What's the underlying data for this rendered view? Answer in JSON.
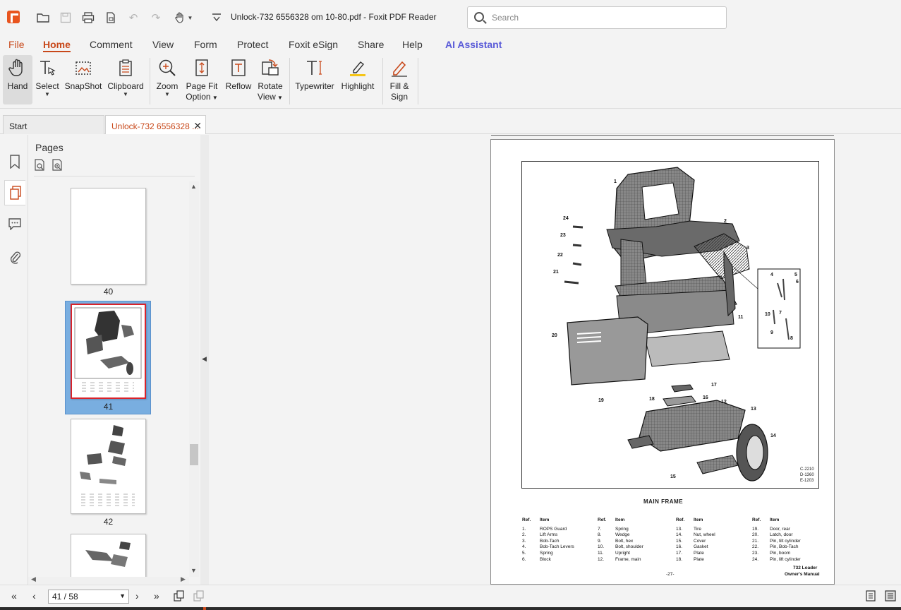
{
  "window": {
    "title": "Unlock-732 6556328 om 10-80.pdf - Foxit PDF Reader",
    "search_placeholder": "Search"
  },
  "quick_access": [
    {
      "name": "open-icon"
    },
    {
      "name": "save-icon"
    },
    {
      "name": "print-icon"
    },
    {
      "name": "new-page-icon"
    },
    {
      "name": "undo-icon"
    },
    {
      "name": "redo-icon"
    },
    {
      "name": "hand-tool-icon"
    },
    {
      "name": "customize-icon"
    }
  ],
  "menu_tabs": [
    "File",
    "Home",
    "Comment",
    "View",
    "Form",
    "Protect",
    "Foxit eSign",
    "Share",
    "Help",
    "AI Assistant"
  ],
  "active_menu_tab": "Home",
  "ribbon": {
    "hand": "Hand",
    "select": "Select",
    "snapshot": "SnapShot",
    "clipboard": "Clipboard",
    "zoom": "Zoom",
    "page_fit_1": "Page Fit",
    "page_fit_2": "Option",
    "reflow": "Reflow",
    "rotate_1": "Rotate",
    "rotate_2": "View",
    "typewriter": "Typewriter",
    "highlight": "Highlight",
    "fill_sign_1": "Fill &",
    "fill_sign_2": "Sign"
  },
  "doc_tabs": {
    "start": "Start",
    "active": "Unlock-732 6556328 ..."
  },
  "pages_panel": {
    "title": "Pages",
    "thumbnails": [
      "40",
      "41",
      "42"
    ],
    "selected": "41"
  },
  "document": {
    "figure_title": "MAIN FRAME",
    "figure_codes": [
      "C-2210",
      "D-1360",
      "E-1203"
    ],
    "callouts": [
      "1",
      "2",
      "3",
      "4",
      "5",
      "6",
      "7",
      "8",
      "9",
      "10",
      "11",
      "12",
      "13",
      "14",
      "15",
      "16",
      "17",
      "18",
      "19",
      "20",
      "21",
      "22",
      "23",
      "24"
    ],
    "ref_header": {
      "ref": "Ref.",
      "item": "Item"
    },
    "parts_columns": [
      [
        [
          "1.",
          "ROPS Guard"
        ],
        [
          "2.",
          "Lift Arms"
        ],
        [
          "3.",
          "Bob-Tach"
        ],
        [
          "4.",
          "Bob-Tach Levers"
        ],
        [
          "5.",
          "Spring"
        ],
        [
          "6.",
          "Block"
        ]
      ],
      [
        [
          "7.",
          "Spring"
        ],
        [
          "8.",
          "Wedge"
        ],
        [
          "9.",
          "Bolt, hex"
        ],
        [
          "10.",
          "Bolt, shoulder"
        ],
        [
          "11.",
          "Upright"
        ],
        [
          "12.",
          "Frame, main"
        ]
      ],
      [
        [
          "13.",
          "Tire"
        ],
        [
          "14.",
          "Nut, wheel"
        ],
        [
          "15.",
          "Cover"
        ],
        [
          "16.",
          "Gasket"
        ],
        [
          "17.",
          "Plate"
        ],
        [
          "18.",
          "Plate"
        ]
      ],
      [
        [
          "19.",
          "Door, rear"
        ],
        [
          "20.",
          "Latch, door"
        ],
        [
          "21.",
          "Pin, tilt cylinder"
        ],
        [
          "22.",
          "Pin, Bob-Tach"
        ],
        [
          "23.",
          "Pin, boom"
        ],
        [
          "24.",
          "Pin, lift cylinder"
        ]
      ]
    ],
    "page_number": "-27-",
    "footer_1": "732 Loader",
    "footer_2": "Owner's Manual"
  },
  "status": {
    "page_indicator": "41 / 58"
  },
  "colors": {
    "accent": "#c8481a",
    "ai": "#5a5bd8",
    "selection": "#79aee0"
  }
}
